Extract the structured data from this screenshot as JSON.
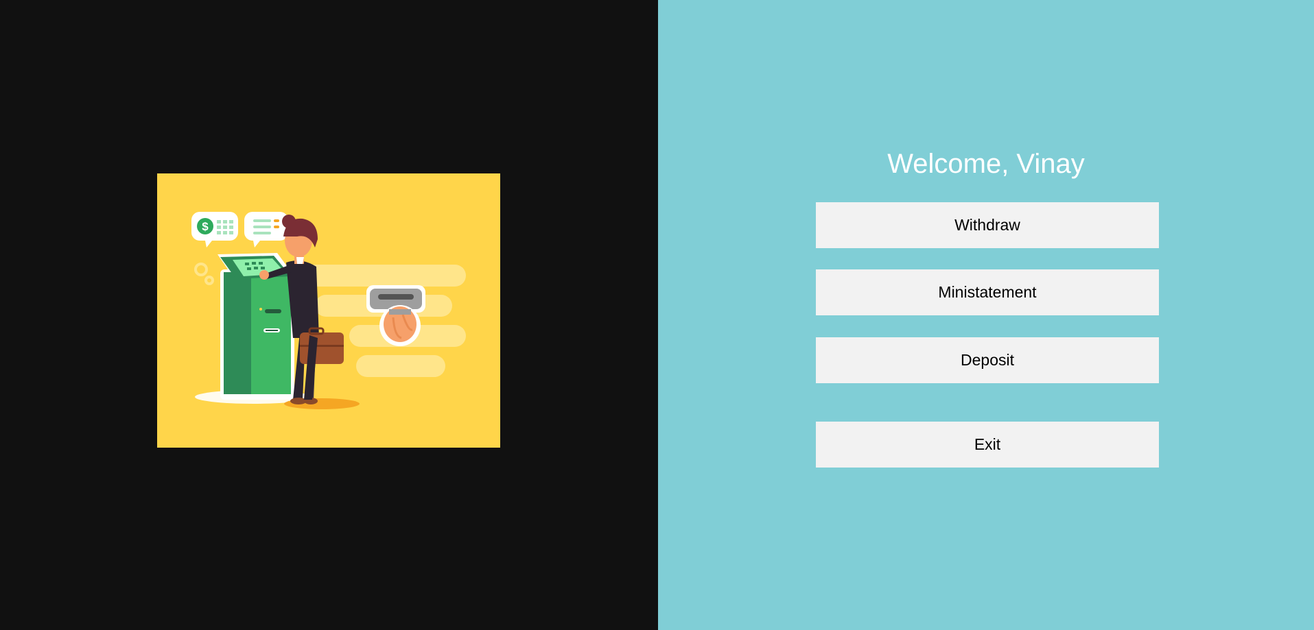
{
  "welcome": {
    "title": "Welcome, Vinay"
  },
  "menu": {
    "withdraw_label": "Withdraw",
    "ministatement_label": "Ministatement",
    "deposit_label": "Deposit",
    "exit_label": "Exit"
  },
  "illustration": {
    "icon": "atm-illustration",
    "currency_symbol": "$"
  },
  "colors": {
    "left_background": "#111111",
    "right_background": "#80ced6",
    "button_background": "#f2f2f2",
    "illustration_background": "#ffd54a"
  }
}
